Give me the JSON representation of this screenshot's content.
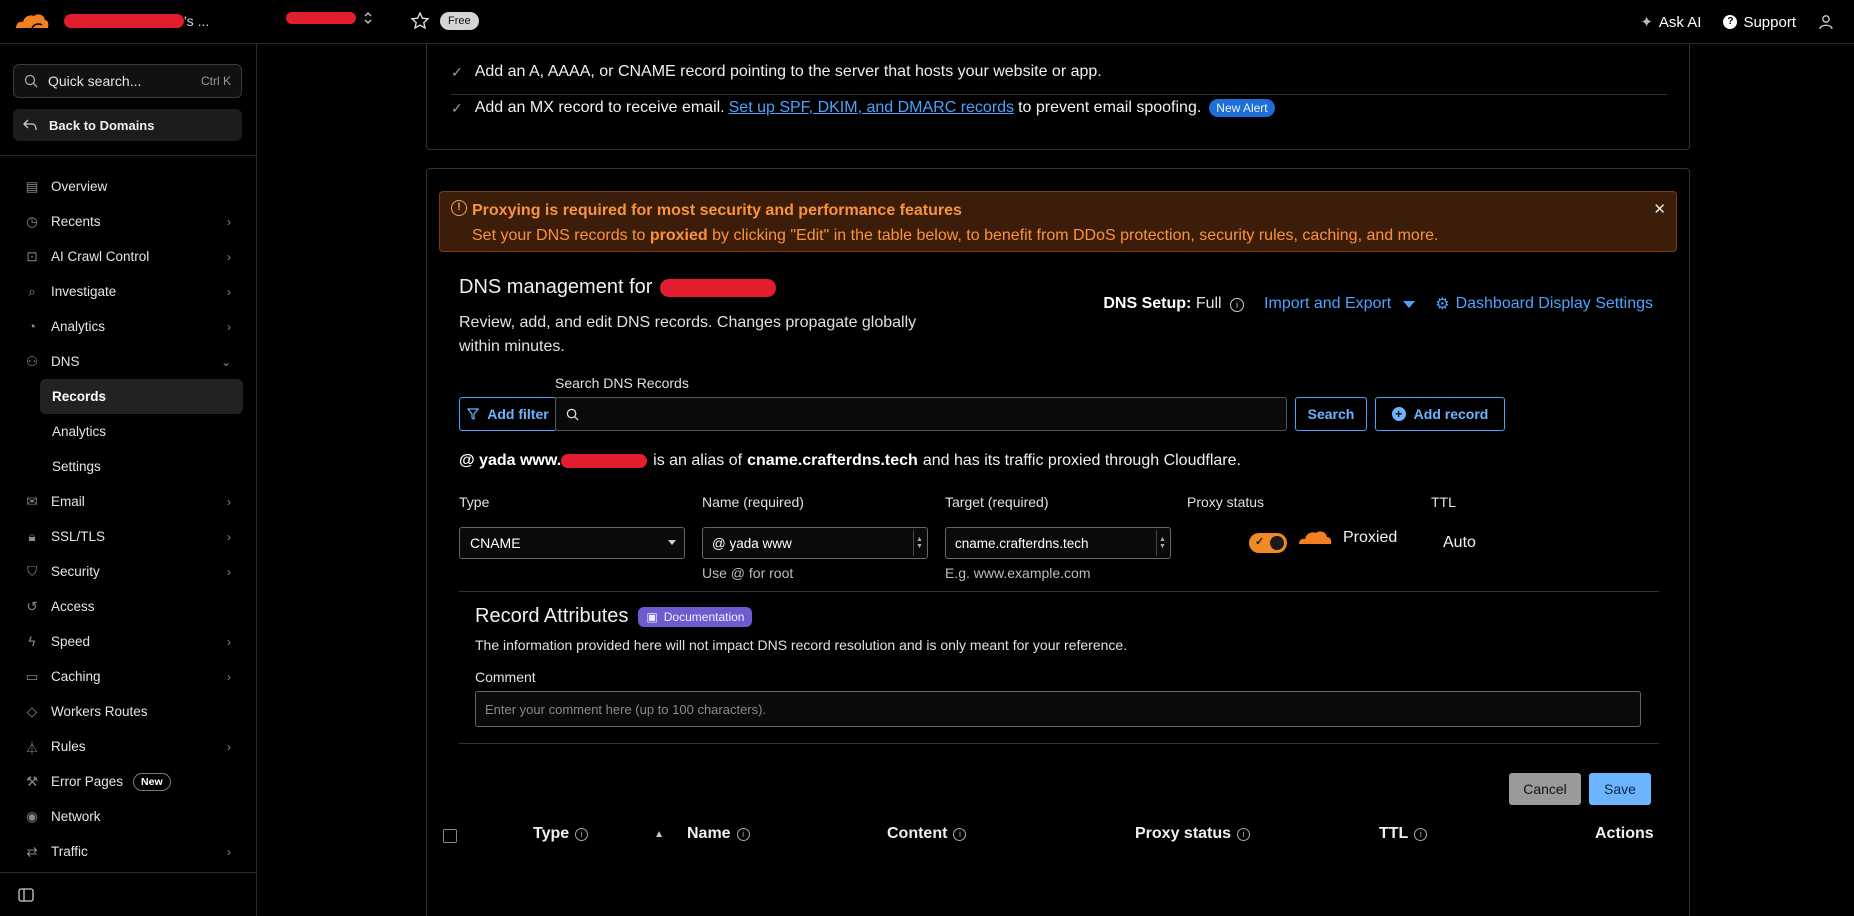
{
  "topbar": {
    "account_suffix": "'s ...",
    "free_badge": "Free",
    "ask_ai": "Ask AI",
    "support": "Support"
  },
  "sidebar": {
    "quick_search": "Quick search...",
    "quick_search_kbd": "Ctrl K",
    "back": "Back to Domains",
    "items": [
      {
        "label": "Overview",
        "icon": "document-icon",
        "chevron": false
      },
      {
        "label": "Recents",
        "icon": "clock-icon",
        "chevron": true
      },
      {
        "label": "AI Crawl Control",
        "icon": "robot-icon",
        "chevron": true
      },
      {
        "label": "Investigate",
        "icon": "magnifier-icon",
        "chevron": true
      },
      {
        "label": "Analytics",
        "icon": "chart-icon",
        "chevron": true
      },
      {
        "label": "DNS",
        "icon": "network-icon",
        "chevron": "down"
      },
      {
        "label": "Records",
        "sub": true,
        "active": true
      },
      {
        "label": "Analytics",
        "sub": true
      },
      {
        "label": "Settings",
        "sub": true
      },
      {
        "label": "Email",
        "icon": "mail-icon",
        "chevron": true
      },
      {
        "label": "SSL/TLS",
        "icon": "lock-icon",
        "chevron": true
      },
      {
        "label": "Security",
        "icon": "shield-icon",
        "chevron": true
      },
      {
        "label": "Access",
        "icon": "access-icon",
        "chevron": false
      },
      {
        "label": "Speed",
        "icon": "bolt-icon",
        "chevron": true
      },
      {
        "label": "Caching",
        "icon": "stack-icon",
        "chevron": true
      },
      {
        "label": "Workers Routes",
        "icon": "diamond-icon",
        "chevron": false
      },
      {
        "label": "Rules",
        "icon": "funnel-icon",
        "chevron": true
      },
      {
        "label": "Error Pages",
        "icon": "wrench-icon",
        "chevron": false,
        "badge": "New"
      },
      {
        "label": "Network",
        "icon": "pin-icon",
        "chevron": false
      },
      {
        "label": "Traffic",
        "icon": "traffic-icon",
        "chevron": true
      }
    ]
  },
  "card1": {
    "line1": "Add an A, AAAA, or CNAME record pointing to the server that hosts your website or app.",
    "line2_pre": "Add an MX record to receive email.",
    "line2_link": "Set up SPF, DKIM, and DMARC records",
    "line2_post": "to prevent email spoofing.",
    "line2_badge": "New Alert"
  },
  "alert": {
    "title": "Proxying is required for most security and performance features",
    "body_pre": "Set your DNS records to",
    "body_bold": "proxied",
    "body_post": "by clicking \"Edit\" in the table below, to benefit from DDoS protection, security rules, caching, and more."
  },
  "dns": {
    "title": "DNS management for",
    "desc": "Review, add, and edit DNS records. Changes propagate globally within minutes.",
    "setup_label": "DNS Setup:",
    "setup_value": "Full",
    "import_export": "Import and Export",
    "display_settings": "Dashboard Display Settings",
    "add_filter": "Add filter",
    "search_label": "Search DNS Records",
    "search_btn": "Search",
    "add_record": "Add record"
  },
  "form": {
    "alias_pre": "@ yada www.",
    "alias_mid": "is an alias of",
    "alias_target": "cname.crafterdns.tech",
    "alias_post": "and has its traffic proxied through Cloudflare.",
    "type_label": "Type",
    "type_value": "CNAME",
    "name_label": "Name (required)",
    "name_value": "@ yada www",
    "name_hint": "Use @ for root",
    "target_label": "Target (required)",
    "target_value": "cname.crafterdns.tech",
    "target_hint": "E.g. www.example.com",
    "proxy_label": "Proxy status",
    "proxy_value": "Proxied",
    "ttl_label": "TTL",
    "ttl_value": "Auto",
    "ra_title": "Record Attributes",
    "ra_doc": "Documentation",
    "ra_desc": "The information provided here will not impact DNS record resolution and is only meant for your reference.",
    "comment_label": "Comment",
    "comment_placeholder": "Enter your comment here (up to 100 characters).",
    "cancel": "Cancel",
    "save": "Save"
  },
  "table": {
    "headers": [
      "Type",
      "Name",
      "Content",
      "Proxy status",
      "TTL",
      "Actions"
    ]
  },
  "colors": {
    "accent_blue": "#4aa3ff",
    "orange": "#f38020",
    "alert_text": "#fb923c"
  }
}
